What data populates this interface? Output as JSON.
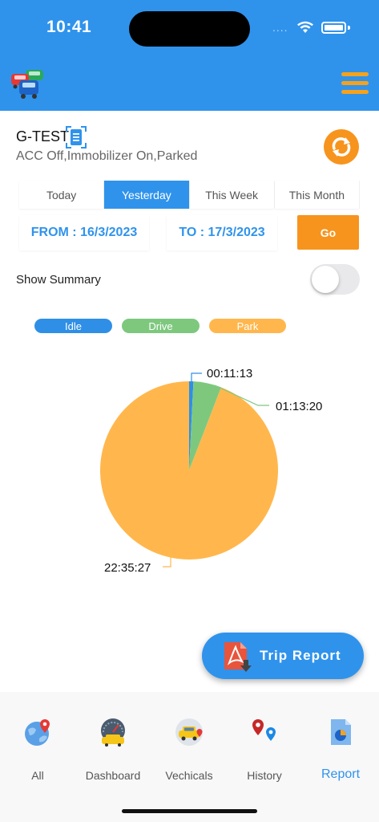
{
  "status_bar": {
    "time": "10:41",
    "dots": "...."
  },
  "vehicle": {
    "name": "G-TEST",
    "status": "ACC Off,Immobilizer On,Parked"
  },
  "tabs": [
    {
      "label": "Today",
      "active": false
    },
    {
      "label": "Yesterday",
      "active": true
    },
    {
      "label": "This Week",
      "active": false
    },
    {
      "label": "This Month",
      "active": false
    }
  ],
  "date_range": {
    "from": "FROM : 16/3/2023",
    "to": "TO : 17/3/2023",
    "go_label": "Go"
  },
  "summary": {
    "label": "Show Summary",
    "enabled": false
  },
  "legend": [
    {
      "label": "Idle",
      "color": "#2f8fe6"
    },
    {
      "label": "Drive",
      "color": "#7ec87e"
    },
    {
      "label": "Park",
      "color": "#ffb74d"
    }
  ],
  "chart_data": {
    "type": "pie",
    "categories": [
      "Idle",
      "Drive",
      "Park"
    ],
    "values": [
      "00:11:13",
      "01:13:20",
      "22:35:27"
    ],
    "seconds": [
      673,
      4400,
      81327
    ],
    "colors": [
      "#2f8fe6",
      "#7ec87e",
      "#ffb74d"
    ]
  },
  "trip_report": {
    "label": "Trip Report"
  },
  "bottom_nav": [
    {
      "label": "All",
      "icon": "globe-pin-icon",
      "active": false
    },
    {
      "label": "Dashboard",
      "icon": "speedometer-car-icon",
      "active": false
    },
    {
      "label": "Vechicals",
      "icon": "car-pin-icon",
      "active": false
    },
    {
      "label": "History",
      "icon": "map-pins-icon",
      "active": false
    },
    {
      "label": "Report",
      "icon": "pie-report-icon",
      "active": true
    }
  ]
}
